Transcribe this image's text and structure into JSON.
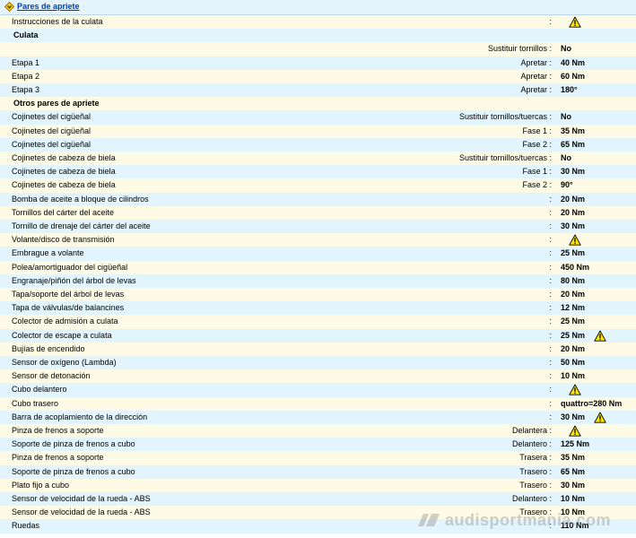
{
  "header": {
    "title": "Pares de apriete",
    "icon": "diamond-arrow-icon"
  },
  "icons": {
    "warning": "warning-triangle-icon"
  },
  "rows": [
    {
      "type": "item",
      "label": "Instrucciones de la culata",
      "condition": "",
      "value": "",
      "warn": true,
      "bg": "y"
    },
    {
      "type": "section",
      "label": "Culata",
      "bg": "b"
    },
    {
      "type": "item",
      "label": "",
      "condition": "Sustituir tornillos",
      "value": "No",
      "warn": false,
      "bg": "y"
    },
    {
      "type": "item",
      "label": "Etapa 1",
      "condition": "Apretar",
      "value": "40 Nm",
      "warn": false,
      "bg": "b"
    },
    {
      "type": "item",
      "label": "Etapa 2",
      "condition": "Apretar",
      "value": "60 Nm",
      "warn": false,
      "bg": "y"
    },
    {
      "type": "item",
      "label": "Etapa 3",
      "condition": "Apretar",
      "value": "180°",
      "warn": false,
      "bg": "b"
    },
    {
      "type": "section",
      "label": "Otros pares de apriete",
      "bg": "y"
    },
    {
      "type": "item",
      "label": "Cojinetes del cigüeñal",
      "condition": "Sustituir tornillos/tuercas",
      "value": "No",
      "warn": false,
      "bg": "b"
    },
    {
      "type": "item",
      "label": "Cojinetes del cigüeñal",
      "condition": "Fase 1",
      "value": "35 Nm",
      "warn": false,
      "bg": "y"
    },
    {
      "type": "item",
      "label": "Cojinetes del cigüeñal",
      "condition": "Fase 2",
      "value": "65 Nm",
      "warn": false,
      "bg": "b"
    },
    {
      "type": "item",
      "label": "Cojinetes de cabeza de biela",
      "condition": "Sustituir tornillos/tuercas",
      "value": "No",
      "warn": false,
      "bg": "y"
    },
    {
      "type": "item",
      "label": "Cojinetes de cabeza de biela",
      "condition": "Fase 1",
      "value": "30 Nm",
      "warn": false,
      "bg": "b"
    },
    {
      "type": "item",
      "label": "Cojinetes de cabeza de biela",
      "condition": "Fase 2",
      "value": "90°",
      "warn": false,
      "bg": "y"
    },
    {
      "type": "item",
      "label": "Bomba de aceite a bloque de cilindros",
      "condition": "",
      "value": "20 Nm",
      "warn": false,
      "bg": "b"
    },
    {
      "type": "item",
      "label": "Tornillos del cárter del aceite",
      "condition": "",
      "value": "20 Nm",
      "warn": false,
      "bg": "y"
    },
    {
      "type": "item",
      "label": "Tornillo de drenaje del cárter del aceite",
      "condition": "",
      "value": "30 Nm",
      "warn": false,
      "bg": "b"
    },
    {
      "type": "item",
      "label": "Volante/disco de transmisión",
      "condition": "",
      "value": "",
      "warn": true,
      "bg": "y"
    },
    {
      "type": "item",
      "label": "Embrague a volante",
      "condition": "",
      "value": "25 Nm",
      "warn": false,
      "bg": "b"
    },
    {
      "type": "item",
      "label": "Polea/amortiguador del cigüeñal",
      "condition": "",
      "value": "450 Nm",
      "warn": false,
      "bg": "y"
    },
    {
      "type": "item",
      "label": "Engranaje/piñón del árbol de levas",
      "condition": "",
      "value": "80 Nm",
      "warn": false,
      "bg": "b"
    },
    {
      "type": "item",
      "label": "Tapa/soporte del árbol de levas",
      "condition": "",
      "value": "20 Nm",
      "warn": false,
      "bg": "y"
    },
    {
      "type": "item",
      "label": "Tapa de válvulas/de balancines",
      "condition": "",
      "value": "12 Nm",
      "warn": false,
      "bg": "b"
    },
    {
      "type": "item",
      "label": "Colector de admisión a culata",
      "condition": "",
      "value": "25 Nm",
      "warn": false,
      "bg": "y"
    },
    {
      "type": "item",
      "label": "Colector de escape a culata",
      "condition": "",
      "value": "25 Nm",
      "warn": true,
      "bg": "b"
    },
    {
      "type": "item",
      "label": "Bujías de encendido",
      "condition": "",
      "value": "20 Nm",
      "warn": false,
      "bg": "y"
    },
    {
      "type": "item",
      "label": "Sensor de oxígeno (Lambda)",
      "condition": "",
      "value": "50 Nm",
      "warn": false,
      "bg": "b"
    },
    {
      "type": "item",
      "label": "Sensor de detonación",
      "condition": "",
      "value": "10 Nm",
      "warn": false,
      "bg": "y"
    },
    {
      "type": "item",
      "label": "Cubo delantero",
      "condition": "",
      "value": "",
      "warn": true,
      "bg": "b"
    },
    {
      "type": "item",
      "label": "Cubo trasero",
      "condition": "",
      "value": "quattro=280 Nm",
      "warn": false,
      "bg": "y"
    },
    {
      "type": "item",
      "label": "Barra de acoplamiento de la dirección",
      "condition": "",
      "value": "30 Nm",
      "warn": true,
      "bg": "b"
    },
    {
      "type": "item",
      "label": "Pinza de frenos a soporte",
      "condition": "Delantera",
      "value": "",
      "warn": true,
      "bg": "y"
    },
    {
      "type": "item",
      "label": "Soporte de pinza de frenos a cubo",
      "condition": "Delantero",
      "value": "125 Nm",
      "warn": false,
      "bg": "b"
    },
    {
      "type": "item",
      "label": "Pinza de frenos a soporte",
      "condition": "Trasera",
      "value": "35 Nm",
      "warn": false,
      "bg": "y"
    },
    {
      "type": "item",
      "label": "Soporte de pinza de frenos a cubo",
      "condition": "Trasero",
      "value": "65 Nm",
      "warn": false,
      "bg": "b"
    },
    {
      "type": "item",
      "label": "Plato fijo a cubo",
      "condition": "Trasero",
      "value": "30 Nm",
      "warn": false,
      "bg": "y"
    },
    {
      "type": "item",
      "label": "Sensor de velocidad de la rueda - ABS",
      "condition": "Delantero",
      "value": "10 Nm",
      "warn": false,
      "bg": "b"
    },
    {
      "type": "item",
      "label": "Sensor de velocidad de la rueda - ABS",
      "condition": "Trasero",
      "value": "10 Nm",
      "warn": false,
      "bg": "y"
    },
    {
      "type": "item",
      "label": "Ruedas",
      "condition": "",
      "value": "110 Nm",
      "warn": false,
      "bg": "b"
    }
  ],
  "watermark": {
    "text": "audisportmania.com"
  }
}
